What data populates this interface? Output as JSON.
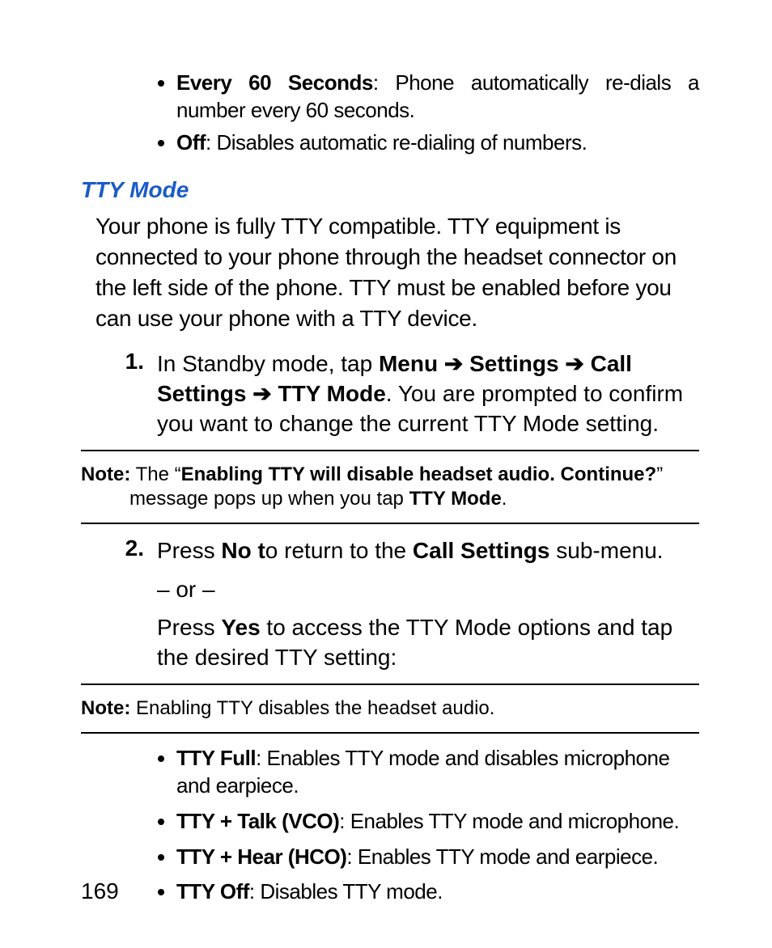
{
  "top_bullets": [
    {
      "lead": "Every 60 Seconds",
      "rest": ": Phone automatically re-dials a number every 60 seconds."
    },
    {
      "lead": "Off",
      "rest": ": Disables automatic re-dialing of numbers."
    }
  ],
  "section_heading": "TTY Mode",
  "intro_paragraph": "Your phone is fully TTY compatible. TTY equipment is connected to your phone through the headset connector on the left side of the phone. TTY must be enabled before you can use your phone with a TTY device.",
  "step1": {
    "num": "1.",
    "pre": "In Standby mode, tap ",
    "path": [
      "Menu",
      "Settings",
      "Call Settings",
      "TTY Mode"
    ],
    "arrow": " ➔ ",
    "post": ". You are prompted to confirm you want to change the current TTY Mode setting."
  },
  "note1": {
    "label": "Note:",
    "pre": " The “",
    "bold": "Enabling TTY will disable headset audio. Continue?",
    "mid": "” message pops up when you tap ",
    "bold2": "TTY Mode",
    "post": "."
  },
  "step2": {
    "num": "2.",
    "line1_pre": "Press ",
    "line1_bold": "No t",
    "line1_mid": "o return to the ",
    "line1_bold2": "Call Settings",
    "line1_post": " sub-menu.",
    "or": "– or –",
    "line2_pre": "Press ",
    "line2_bold": "Yes",
    "line2_post": " to access the TTY Mode options and tap the desired TTY setting:"
  },
  "note2": {
    "label": "Note:",
    "text": " Enabling TTY disables the headset audio."
  },
  "options": [
    {
      "lead": "TTY Full",
      "rest": ": Enables TTY mode and disables microphone and earpiece."
    },
    {
      "lead": "TTY + Talk (VCO)",
      "rest": ": Enables TTY mode and microphone."
    },
    {
      "lead": "TTY + Hear (HCO)",
      "rest": ": Enables TTY mode and earpiece."
    },
    {
      "lead": "TTY Off",
      "rest": ": Disables TTY mode."
    }
  ],
  "page_number": "169"
}
